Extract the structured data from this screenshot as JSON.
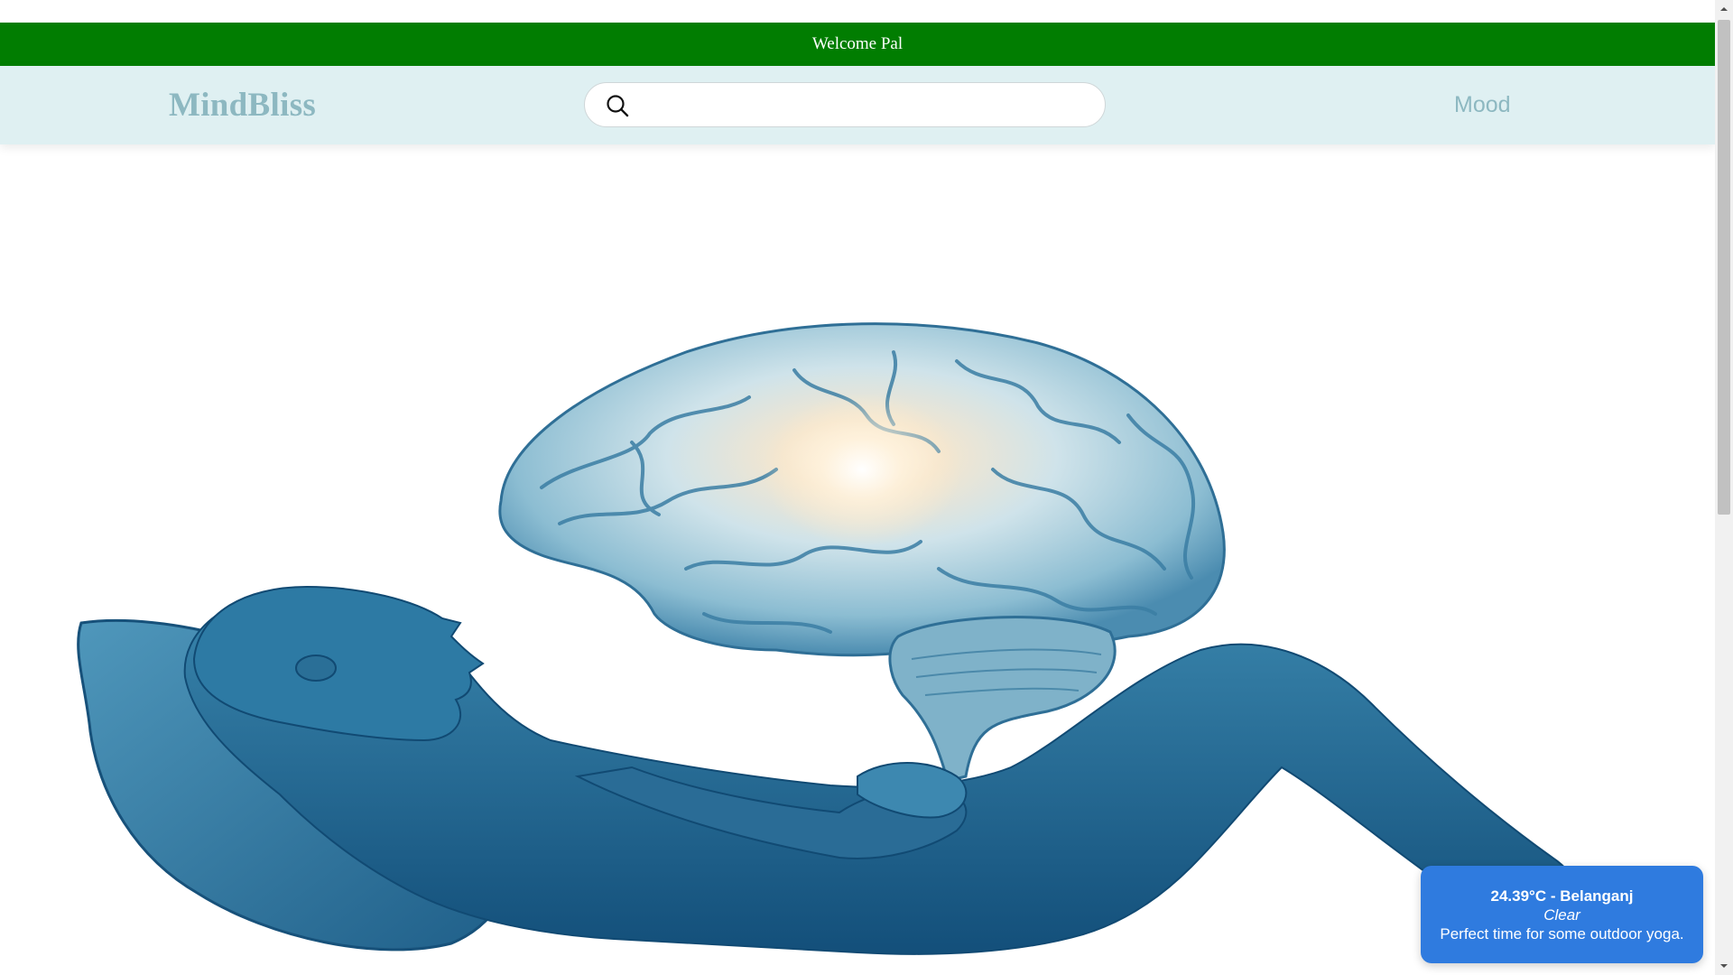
{
  "banner": {
    "welcome_text": "Welcome Pal",
    "color": "#017d01"
  },
  "navbar": {
    "logo_text": "MindBliss",
    "search": {
      "value": "",
      "placeholder": ""
    },
    "mood_link": "Mood",
    "background": "#dff0f2",
    "accent": "#8db8c1"
  },
  "hero": {
    "image": "person-relaxing-with-floating-brain-illustration",
    "tone": "#1d6e98"
  },
  "weather": {
    "title": "24.39°C - Belanganj",
    "condition": "Clear",
    "message": "Perfect time for some outdoor yoga.",
    "color": "#2f7bdf"
  }
}
